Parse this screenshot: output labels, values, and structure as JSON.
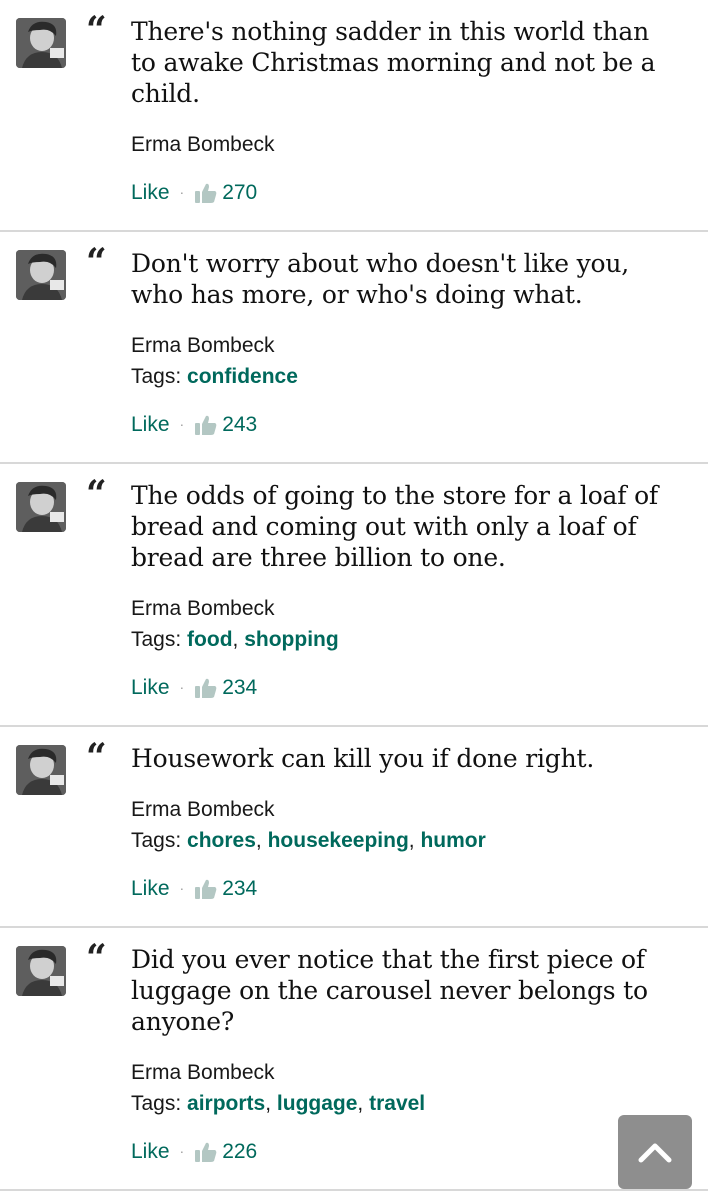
{
  "quotes": [
    {
      "text": "There's nothing sadder in this world than to awake Christmas morning and not be a child.",
      "author": "Erma Bombeck",
      "tags_label": "",
      "tags": [],
      "like_label": "Like",
      "likes": "270"
    },
    {
      "text": "Don't worry about who doesn't like you, who has more, or who's doing what.",
      "author": "Erma Bombeck",
      "tags_label": "Tags:",
      "tags": [
        "confidence"
      ],
      "like_label": "Like",
      "likes": "243"
    },
    {
      "text": "The odds of going to the store for a loaf of bread and coming out with only a loaf of bread are three billion to one.",
      "author": "Erma Bombeck",
      "tags_label": "Tags:",
      "tags": [
        "food",
        "shopping"
      ],
      "like_label": "Like",
      "likes": "234"
    },
    {
      "text": "Housework can kill you if done right.",
      "author": "Erma Bombeck",
      "tags_label": "Tags:",
      "tags": [
        "chores",
        "housekeeping",
        "humor"
      ],
      "like_label": "Like",
      "likes": "234"
    },
    {
      "text": "Did you ever notice that the first piece of luggage on the carousel never belongs to anyone?",
      "author": "Erma Bombeck",
      "tags_label": "Tags:",
      "tags": [
        "airports",
        "luggage",
        "travel"
      ],
      "like_label": "Like",
      "likes": "226"
    }
  ],
  "quote_mark": "“",
  "separator": "·",
  "colors": {
    "link": "#00695c",
    "divider": "#d8d8d8",
    "scroll_button": "#8e8e8e"
  },
  "icons": {
    "avatar": "author-avatar",
    "like": "thumbs-up-icon",
    "scroll": "chevron-up-icon"
  }
}
